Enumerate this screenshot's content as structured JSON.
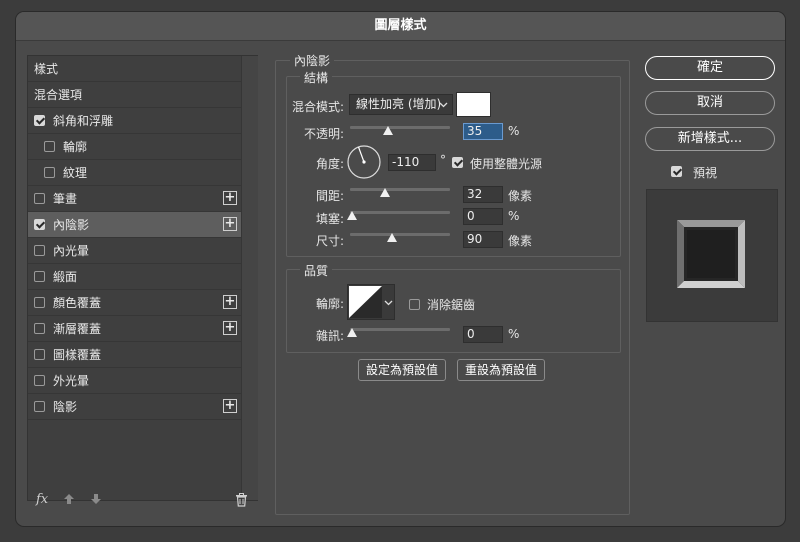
{
  "dialog": {
    "title": "圖層樣式"
  },
  "styles_list": {
    "header": "樣式",
    "blend_options": "混合選項",
    "items": [
      {
        "label": "斜角和浮雕",
        "checked": true
      },
      {
        "label": "輪廓",
        "checked": false
      },
      {
        "label": "紋理",
        "checked": false
      },
      {
        "label": "筆畫",
        "checked": false,
        "add": true
      },
      {
        "label": "內陰影",
        "checked": true,
        "add": true,
        "selected": true
      },
      {
        "label": "內光暈",
        "checked": false
      },
      {
        "label": "緞面",
        "checked": false
      },
      {
        "label": "顏色覆蓋",
        "checked": false,
        "add": true
      },
      {
        "label": "漸層覆蓋",
        "checked": false,
        "add": true
      },
      {
        "label": "圖樣覆蓋",
        "checked": false
      },
      {
        "label": "外光暈",
        "checked": false
      },
      {
        "label": "陰影",
        "checked": false,
        "add": true
      }
    ],
    "fx_label": "fx"
  },
  "inner_shadow": {
    "title": "內陰影",
    "structure": {
      "title": "結構",
      "blend_mode_label": "混合模式:",
      "blend_mode_value": "線性加亮 (增加)",
      "blend_color": "#ffffff",
      "opacity_label": "不透明:",
      "opacity_value": "35",
      "opacity_unit": "%",
      "opacity_level": 0.35,
      "angle_label": "角度:",
      "angle_value": "-110",
      "angle_unit": "°",
      "global_light_label": "使用整體光源",
      "global_light_checked": true,
      "distance_label": "間距:",
      "distance_value": "32",
      "distance_unit": "像素",
      "choke_label": "填塞:",
      "choke_value": "0",
      "choke_unit": "%",
      "size_label": "尺寸:",
      "size_value": "90",
      "size_unit": "像素"
    },
    "quality": {
      "title": "品質",
      "contour_label": "輪廓:",
      "anti_alias_label": "消除鋸齒",
      "anti_alias_checked": false,
      "noise_label": "雜訊:",
      "noise_value": "0",
      "noise_unit": "%"
    },
    "make_default": "設定為預設值",
    "reset_default": "重設為預設值"
  },
  "actions": {
    "ok": "確定",
    "cancel": "取消",
    "new_style": "新增樣式...",
    "preview_label": "預視",
    "preview_checked": true
  }
}
